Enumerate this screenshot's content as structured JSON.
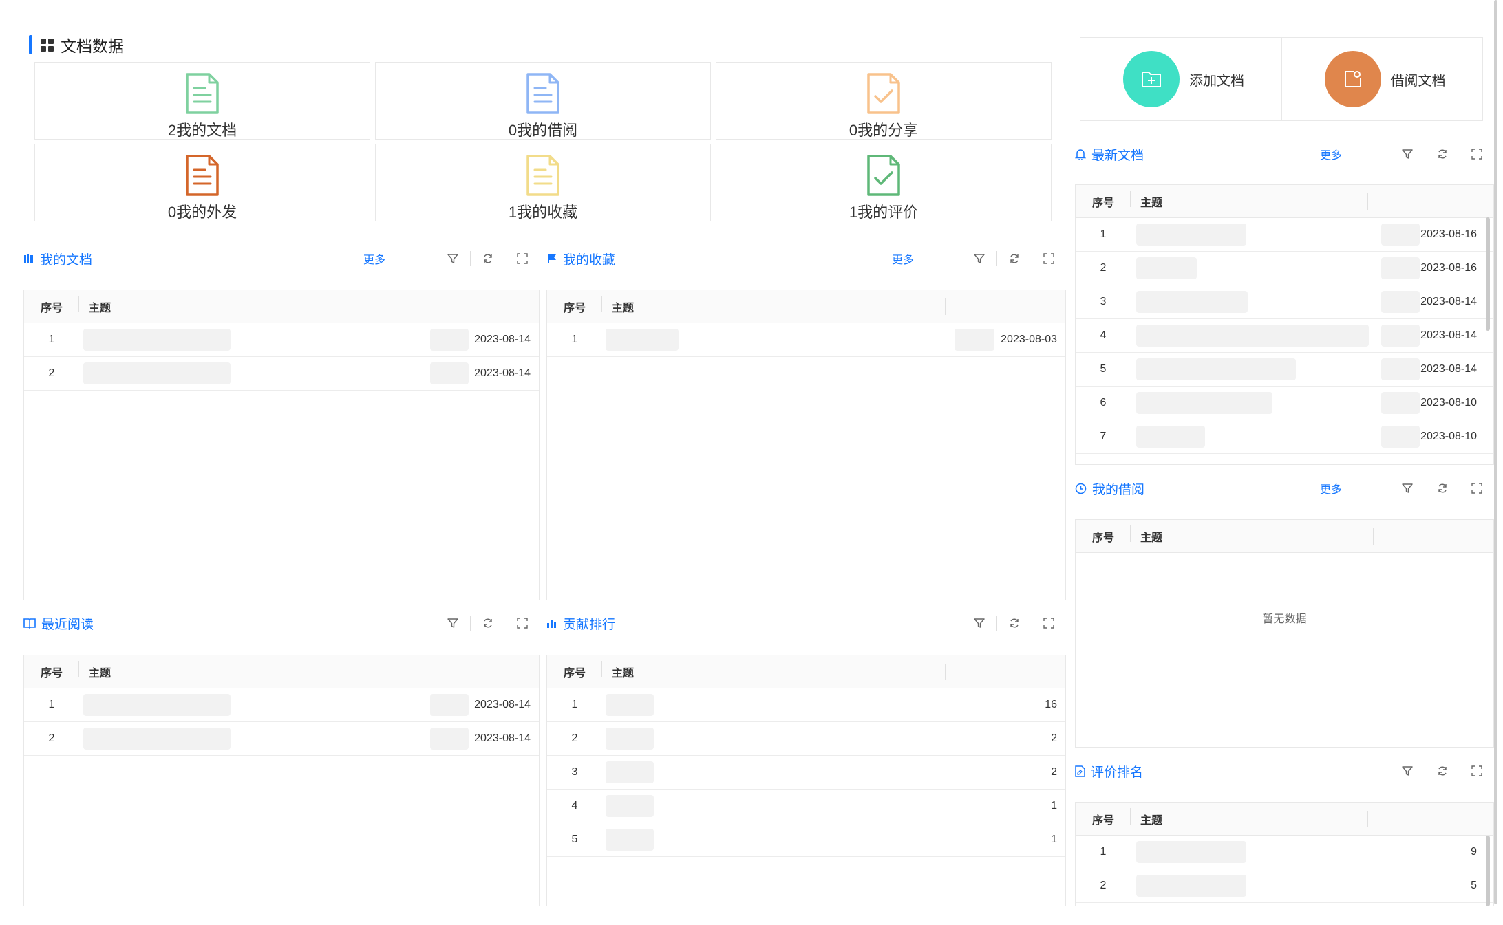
{
  "section": {
    "title": "文档数据"
  },
  "stats": [
    {
      "label": "2我的文档",
      "icon": "document-icon",
      "color": "#7fd19f",
      "kind": "lines"
    },
    {
      "label": "0我的借阅",
      "icon": "document-icon",
      "color": "#8fb6f5",
      "kind": "lines"
    },
    {
      "label": "0我的分享",
      "icon": "document-check-icon",
      "color": "#f8c28c",
      "kind": "check"
    },
    {
      "label": "0我的外发",
      "icon": "document-icon",
      "color": "#d4662a",
      "kind": "lines"
    },
    {
      "label": "1我的收藏",
      "icon": "document-icon",
      "color": "#f2dc8a",
      "kind": "lines"
    },
    {
      "label": "1我的评价",
      "icon": "document-check-icon",
      "color": "#5fb878",
      "kind": "check"
    }
  ],
  "quick_actions": [
    {
      "label": "添加文档",
      "icon": "folder-add-icon",
      "color": "#3fe0c5"
    },
    {
      "label": "借阅文档",
      "icon": "borrow-icon",
      "color": "#e0864c"
    }
  ],
  "common": {
    "more": "更多",
    "col_index": "序号",
    "col_subject": "主题"
  },
  "panels": {
    "my_docs": {
      "title": "我的文档",
      "rows": [
        {
          "idx": "1",
          "value": "2023-08-14"
        },
        {
          "idx": "2",
          "value": "2023-08-14"
        }
      ]
    },
    "my_favorites": {
      "title": "我的收藏",
      "rows": [
        {
          "idx": "1",
          "value": "2023-08-03"
        }
      ]
    },
    "recent_read": {
      "title": "最近阅读",
      "rows": [
        {
          "idx": "1",
          "value": "2023-08-14"
        },
        {
          "idx": "2",
          "value": "2023-08-14"
        }
      ]
    },
    "contribution": {
      "title": "贡献排行",
      "rows": [
        {
          "idx": "1",
          "value": "16"
        },
        {
          "idx": "2",
          "value": "2"
        },
        {
          "idx": "3",
          "value": "2"
        },
        {
          "idx": "4",
          "value": "1"
        },
        {
          "idx": "5",
          "value": "1"
        }
      ]
    },
    "latest_docs": {
      "title": "最新文档",
      "rows": [
        {
          "idx": "1",
          "value": "2023-08-16"
        },
        {
          "idx": "2",
          "value": "2023-08-16"
        },
        {
          "idx": "3",
          "value": "2023-08-14"
        },
        {
          "idx": "4",
          "value": "2023-08-14"
        },
        {
          "idx": "5",
          "value": "2023-08-14"
        },
        {
          "idx": "6",
          "value": "2023-08-10"
        },
        {
          "idx": "7",
          "value": "2023-08-10"
        }
      ]
    },
    "my_borrow": {
      "title": "我的借阅",
      "empty": "暂无数据"
    },
    "rating_rank": {
      "title": "评价排名",
      "rows": [
        {
          "idx": "1",
          "value": "9"
        },
        {
          "idx": "2",
          "value": "5"
        }
      ]
    }
  },
  "colors": {
    "accent": "#1677ff"
  }
}
